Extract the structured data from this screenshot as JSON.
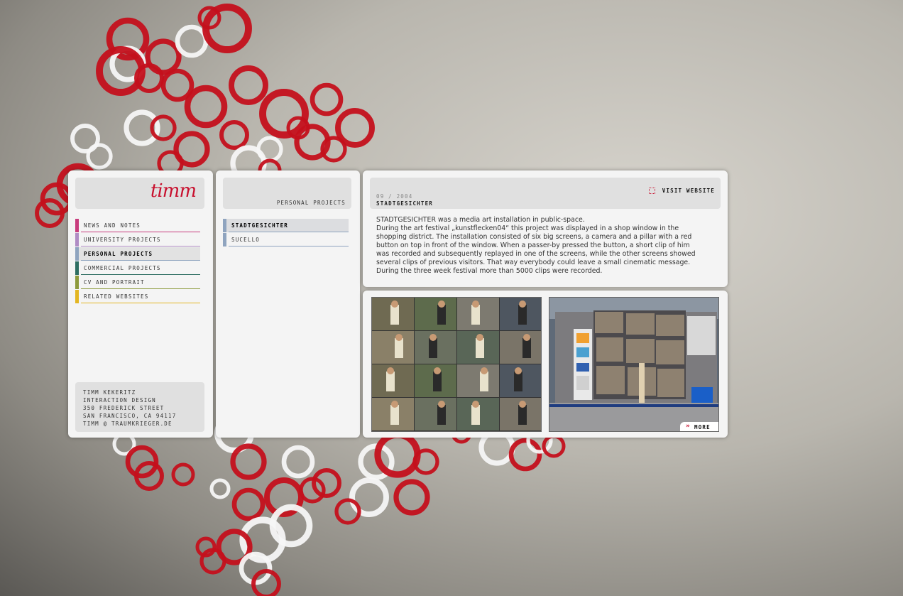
{
  "colors": {
    "accent": "#c8102e",
    "panel": "#f4f4f4",
    "header": "#e0e0e0"
  },
  "logo": {
    "text": "timm"
  },
  "nav": {
    "items": [
      {
        "label": "News and Notes",
        "color": "#c83c7d"
      },
      {
        "label": "University Projects",
        "color": "#b08cc4"
      },
      {
        "label": "Personal Projects",
        "color": "#8fa4bf"
      },
      {
        "label": "Commercial Projects",
        "color": "#2e6e62"
      },
      {
        "label": "CV and Portrait",
        "color": "#8d9a3c"
      },
      {
        "label": "Related Websites",
        "color": "#e3b622"
      }
    ],
    "active": 2
  },
  "contact": {
    "name": "Timm Kekeritz",
    "role": "Interaction Design",
    "street": "350 Frederick Street",
    "city": "San Francisco, CA 94117",
    "email": "Timm @ traumkrieger.de"
  },
  "section": {
    "title": "Personal Projects"
  },
  "projects": {
    "items": [
      "Stadtgesichter",
      "Sucello"
    ],
    "active": 0
  },
  "detail": {
    "date": "09 / 2004",
    "title": "Stadtgesichter",
    "visit_label": "Visit Website",
    "paragraphs": [
      "STADTGESICHTER was a media art installation in public-space.",
      "During the art festival „kunstflecken04“ this project was displayed in a shop window in the",
      "shopping district.  The installation consisted of six big screens, a camera and a pillar with a red",
      "button on top in front of the window. When a passer-by pressed the button, a short clip of him",
      "was recorded and subsequently replayed in one of the screens, while the other screens showed",
      "several clips of previous visitors. That way everybody could leave a small cinematic message.",
      "During the three week festival more than 5000 clips were recorded."
    ]
  },
  "gallery": {
    "more_label": "More"
  }
}
